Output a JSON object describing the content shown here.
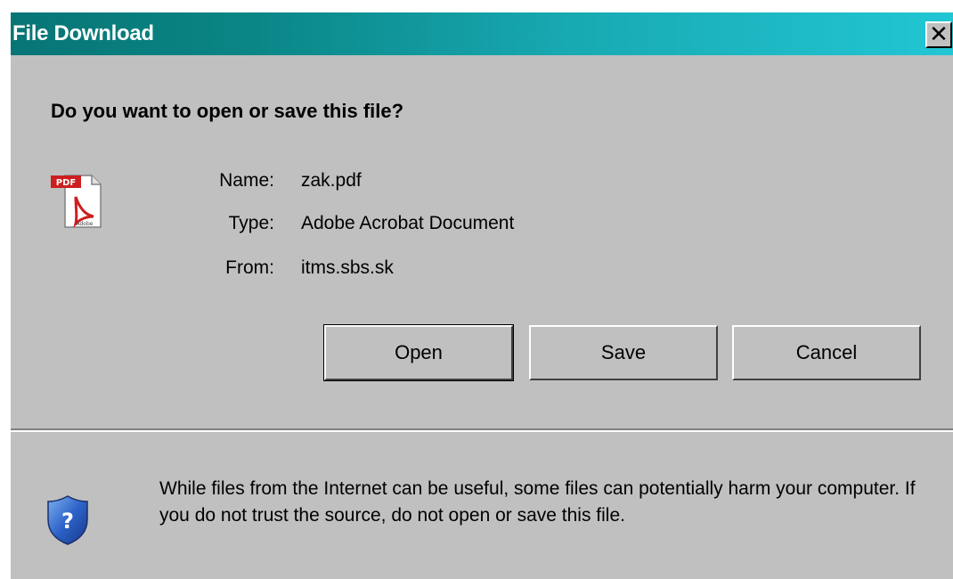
{
  "window": {
    "title": "File Download",
    "close_glyph": "✕"
  },
  "prompt": {
    "question": "Do you want to open or save this file?"
  },
  "file": {
    "icon": "pdf-file-icon",
    "name_label": "Name:",
    "name_value": "zak.pdf",
    "type_label": "Type:",
    "type_value": "Adobe Acrobat Document",
    "from_label": "From:",
    "from_value": "itms.sbs.sk"
  },
  "buttons": {
    "open_label": "Open",
    "save_label": "Save",
    "cancel_label": "Cancel"
  },
  "warning": {
    "icon": "shield-question-icon",
    "text": "While files from the Internet can be useful, some files can potentially harm your computer. If you do not trust the source, do not open or save this file."
  },
  "colors": {
    "titlebar_start": "#087575",
    "titlebar_end": "#22c6d4",
    "dialog_bg": "#c0c0c0",
    "pdf_red": "#cc1f1f",
    "shield_blue": "#2d63c8"
  }
}
